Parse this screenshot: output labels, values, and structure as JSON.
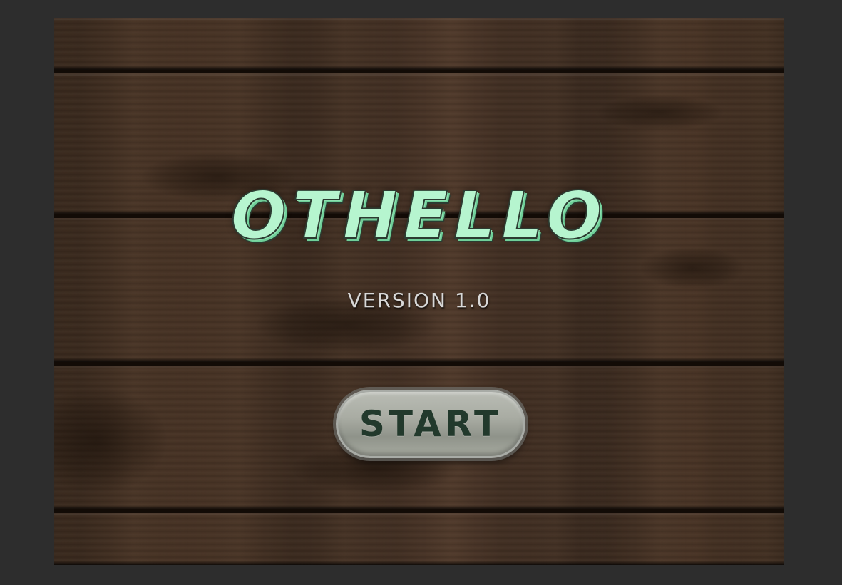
{
  "game": {
    "title": "OTHELLO",
    "version": "VERSION 1.0",
    "start_label": "START"
  },
  "colors": {
    "backdrop": "#2d2d2d",
    "wood": "#3b2a1f",
    "title_fill": "#b6f5cf",
    "title_outline": "#2c3b31",
    "version_text": "#d8d8d8",
    "button_face": "#a9aca3",
    "button_text": "#22392c"
  },
  "icons": []
}
